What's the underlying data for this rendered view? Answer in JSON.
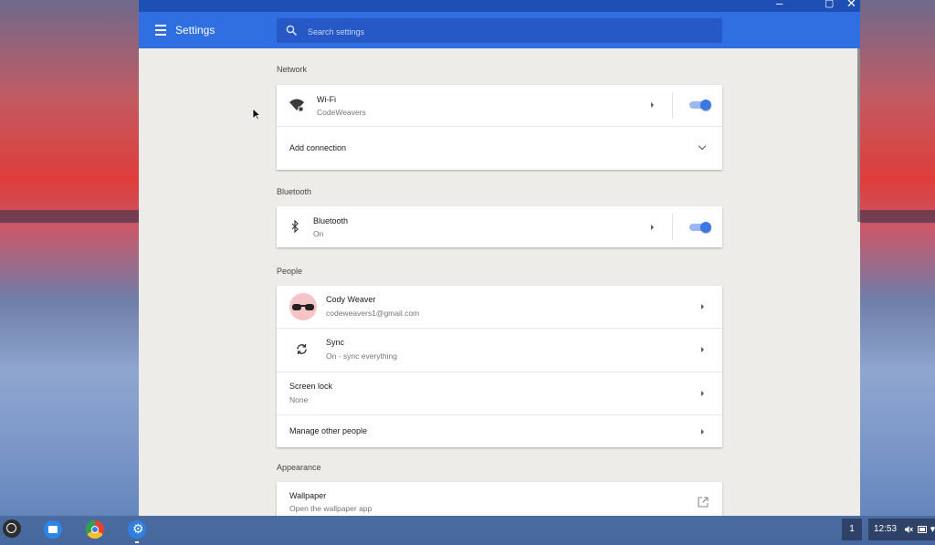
{
  "window": {
    "title": "Settings",
    "controls": [
      "minimize",
      "maximize",
      "close"
    ]
  },
  "search": {
    "placeholder": "Search settings"
  },
  "sections": {
    "network": {
      "title": "Network",
      "wifi": {
        "label": "Wi-Fi",
        "status": "CodeWeavers",
        "enabled": true
      },
      "add_connection": {
        "label": "Add connection"
      }
    },
    "bluetooth": {
      "title": "Bluetooth",
      "bluetooth": {
        "label": "Bluetooth",
        "status": "On",
        "enabled": true
      }
    },
    "people": {
      "title": "People",
      "account": {
        "name": "Cody Weaver",
        "email": "codeweavers1@gmail.com"
      },
      "sync": {
        "label": "Sync",
        "status": "On - sync everything"
      },
      "screen_lock": {
        "label": "Screen lock",
        "status": "None"
      },
      "manage_people": {
        "label": "Manage other people"
      }
    },
    "appearance": {
      "title": "Appearance",
      "wallpaper": {
        "label": "Wallpaper",
        "status": "Open the wallpaper app"
      }
    }
  },
  "shelf": {
    "apps": [
      "launcher",
      "files",
      "chrome",
      "settings"
    ],
    "notification_count": "1",
    "time": "12:53"
  },
  "colors": {
    "accent": "#2f6fe1",
    "titlebar": "#1e4fb4",
    "toggle_on": "#3c78e3"
  },
  "icons": [
    "menu-icon",
    "search-icon",
    "wifi-icon",
    "bluetooth-icon",
    "sync-icon",
    "open-external-icon",
    "mute-icon",
    "battery-icon"
  ]
}
